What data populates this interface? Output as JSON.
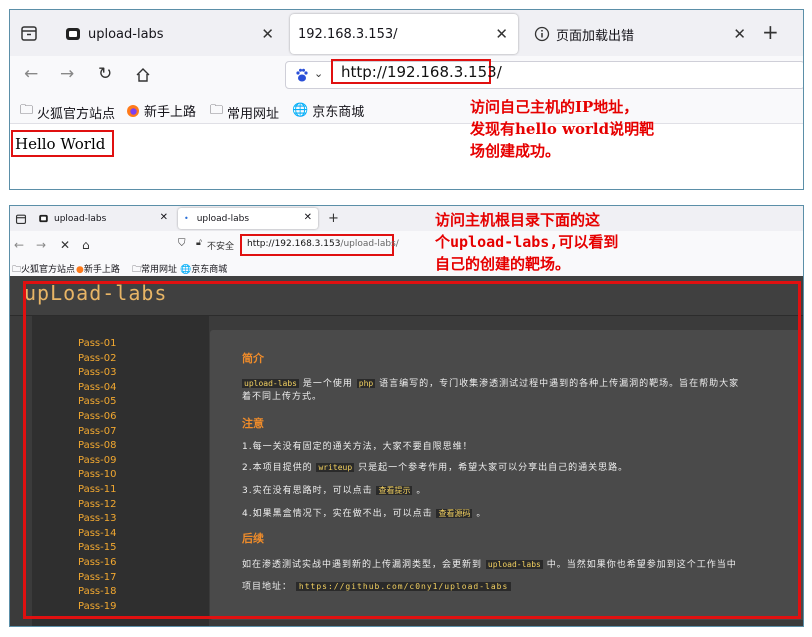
{
  "top": {
    "tabs": [
      {
        "label": "upload-labs"
      },
      {
        "label": "192.168.3.153/"
      },
      {
        "label": "页面加载出错"
      }
    ],
    "url": "http://192.168.3.153/",
    "bookmarks": [
      "火狐官方站点",
      "新手上路",
      "常用网址",
      "京东商城"
    ],
    "hello": "Hello World",
    "annotation": [
      "访问自己主机的IP地址，",
      "发现有hello world说明靶",
      "场创建成功。"
    ]
  },
  "bottom": {
    "tabs": [
      {
        "label": "upload-labs"
      },
      {
        "label": "upload-labs"
      }
    ],
    "url_security": "不安全",
    "url_host": "http://192.168.3.153",
    "url_path": "/upload-labs/",
    "bookmarks": [
      "火狐官方站点",
      "新手上路",
      "常用网址",
      "京东商城"
    ],
    "annotation": [
      "访问主机根目录下面的这",
      "个upload-labs,可以看到",
      "自己的创建的靶场。"
    ],
    "logo": "upLoad-labs",
    "passes": [
      "Pass-01",
      "Pass-02",
      "Pass-03",
      "Pass-04",
      "Pass-05",
      "Pass-06",
      "Pass-07",
      "Pass-08",
      "Pass-09",
      "Pass-10",
      "Pass-11",
      "Pass-12",
      "Pass-13",
      "Pass-14",
      "Pass-15",
      "Pass-16",
      "Pass-17",
      "Pass-18",
      "Pass-19"
    ],
    "intro_title": "简介",
    "intro_code": "upload-labs",
    "intro_a": "是一个使用",
    "intro_php": "php",
    "intro_b": "语言编写的，专门收集渗透测试过程中遇到的各种上传漏洞的靶场。旨在帮助大家",
    "intro_c": "着不同上传方式。",
    "note_title": "注意",
    "note1": "1.每一关没有固定的通关方法，大家不要自限思维！",
    "note2a": "2.本项目提供的",
    "note2_code": "writeup",
    "note2b": "只是起一个参考作用，希望大家可以分享出自己的通关思路。",
    "note3a": "3.实在没有思路时，可以点击",
    "note3_code": "查看提示",
    "note3b": "。",
    "note4a": "4.如果黑盒情况下，实在做不出，可以点击",
    "note4_code": "查看源码",
    "note4b": "。",
    "follow_title": "后续",
    "follow_a": "如在渗透测试实战中遇到新的上传漏洞类型，会更新到",
    "follow_code": "upload-labs",
    "follow_b": "中。当然如果你也希望参加到这个工作当中",
    "project_label": "项目地址：",
    "project_url": "https://github.com/c0ny1/upload-labs"
  },
  "colors": {
    "annotation": "#e60000",
    "highlight_box": "#e01010",
    "pass_link": "#f2a830",
    "heading": "#f08c2a"
  }
}
